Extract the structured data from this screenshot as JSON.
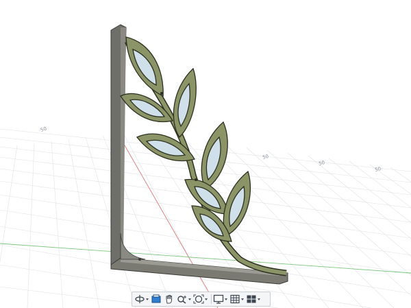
{
  "viewport": {
    "grid_labels": [
      "50",
      "50",
      "50",
      "50"
    ]
  },
  "toolbar": {
    "tools": [
      {
        "icon": "orbit-icon",
        "has_menu": true
      },
      {
        "icon": "look-at-icon",
        "has_menu": false
      },
      {
        "icon": "pan-hand-icon",
        "has_menu": false
      },
      {
        "icon": "zoom-icon",
        "has_menu": true
      },
      {
        "icon": "fit-icon",
        "has_menu": true
      },
      {
        "icon": "display-settings-icon",
        "has_menu": true
      },
      {
        "icon": "grid-snap-icon",
        "has_menu": true
      },
      {
        "icon": "viewports-icon",
        "has_menu": true
      }
    ]
  },
  "colors": {
    "background": "#ffffff",
    "grid": "#dfe2e6",
    "x_axis": "#e07a7a",
    "y_axis": "#7cc77c",
    "bracket": "#6f6f69",
    "leaf_green": "#8b9466",
    "leaf_glass": "#cfe0ea"
  }
}
